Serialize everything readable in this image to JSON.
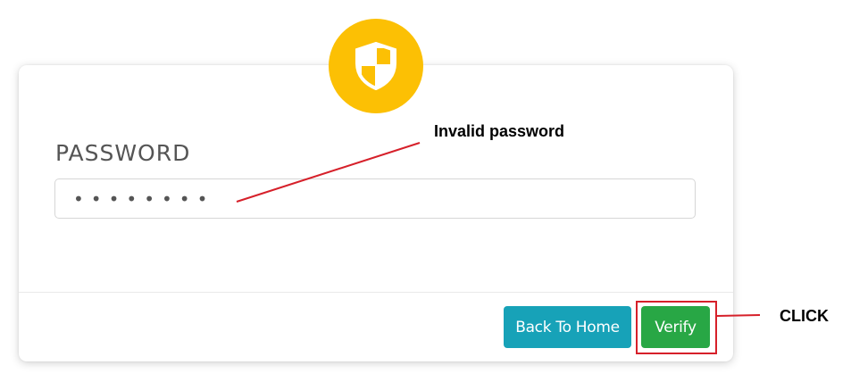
{
  "form": {
    "icon": "shield-icon",
    "password_label": "PASSWORD",
    "password_value": "••••••••",
    "back_button_label": "Back To Home",
    "verify_button_label": "Verify"
  },
  "annotations": {
    "invalid_password_note": "Invalid password",
    "click_note": "CLICK"
  },
  "colors": {
    "badge": "#fcc004",
    "back_button": "#17a2b8",
    "verify_button": "#28a745",
    "annotation_red": "#d6202a"
  }
}
